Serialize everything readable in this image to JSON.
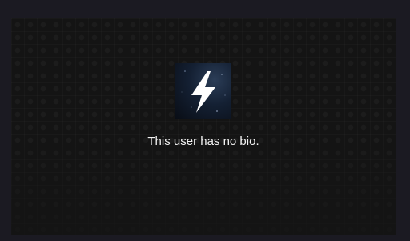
{
  "profile": {
    "bio_empty_message": "This user has no bio.",
    "avatar_icon": "lightning-bolt-icon"
  },
  "colors": {
    "page_background": "#1b1a22",
    "panel_background": "#141414",
    "text": "#f2f2f2"
  }
}
